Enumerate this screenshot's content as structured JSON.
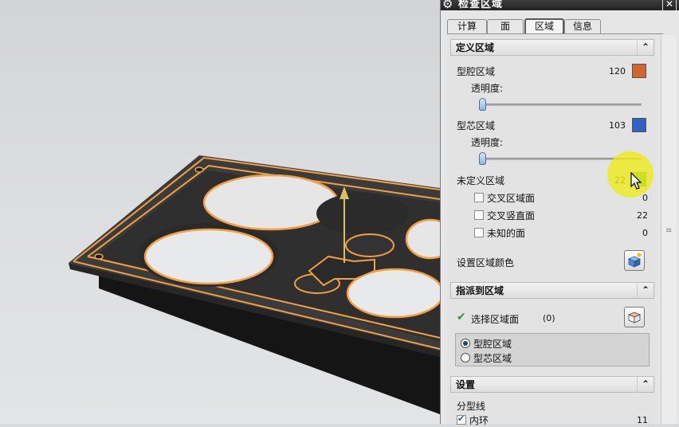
{
  "dialog": {
    "title": "检查区域",
    "tabs": [
      {
        "label": "计算",
        "active": false
      },
      {
        "label": "面",
        "active": false
      },
      {
        "label": "区域",
        "active": true
      },
      {
        "label": "信息",
        "active": false
      }
    ],
    "define": {
      "header": "定义区域",
      "cavity": {
        "label": "型腔区域",
        "count": "120",
        "color": "#d2642e",
        "transparency_label": "透明度:",
        "transparency": 0
      },
      "core": {
        "label": "型芯区域",
        "count": "103",
        "color": "#2f62c8",
        "transparency_label": "透明度:",
        "transparency": 0
      },
      "undefined": {
        "label": "未定义区域",
        "count": "22",
        "color": "#2db52d"
      },
      "subitems": [
        {
          "label": "交叉区域面",
          "count": "0",
          "checked": false
        },
        {
          "label": "交叉竖直面",
          "count": "22",
          "checked": false
        },
        {
          "label": "未知的面",
          "count": "0",
          "checked": false
        }
      ],
      "set_color_label": "设置区域颜色"
    },
    "assign": {
      "header": "指派到区域",
      "select_label": "选择区域面",
      "select_count": "(0)",
      "options": [
        {
          "label": "型腔区域",
          "selected": true
        },
        {
          "label": "型芯区域",
          "selected": false
        }
      ]
    },
    "settings": {
      "header": "设置",
      "parting_line_label": "分型线",
      "inner_loop_label": "内环",
      "inner_loop_count": "11",
      "inner_loop_checked": true
    }
  },
  "colors": {
    "edge_highlight": "#f2a043",
    "part_body": "#3a3a3a",
    "highlight_cursor": "#eeeb1e"
  }
}
